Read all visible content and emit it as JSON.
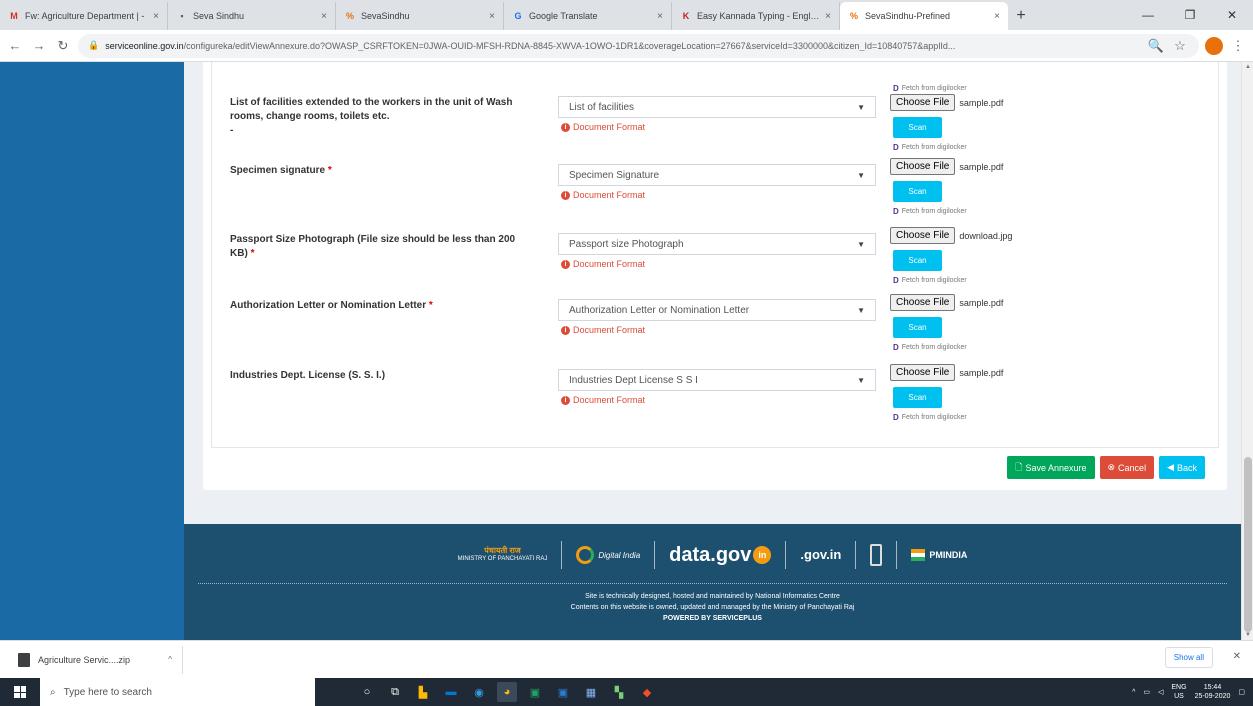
{
  "browser": {
    "tabs": [
      {
        "title": "Fw: Agriculture Department | -",
        "icon": "gmail-icon",
        "color": "#d93025",
        "active": false
      },
      {
        "title": "Seva Sindhu",
        "icon": "doc-icon",
        "color": "#5f6368",
        "active": false
      },
      {
        "title": "SevaSindhu",
        "icon": "sevasindhu-icon",
        "color": "#e8710a",
        "active": false
      },
      {
        "title": "Google Translate",
        "icon": "translate-icon",
        "color": "#1a73e8",
        "active": false
      },
      {
        "title": "Easy Kannada Typing - English",
        "icon": "k-icon",
        "color": "#c5221f",
        "active": false
      },
      {
        "title": "SevaSindhu-Prefined",
        "icon": "sevasindhu-icon",
        "color": "#e8710a",
        "active": true
      }
    ],
    "url_host": "serviceonline.gov.in",
    "url_path": "/configureka/editViewAnnexure.do?OWASP_CSRFTOKEN=0JWA-OUID-MFSH-RDNA-8845-XWVA-1OWO-1DR1&coverageLocation=27667&serviceId=3300000&citizen_Id=10840757&applId..."
  },
  "form": {
    "rows": [
      {
        "label": "List of facilities extended to the workers in the unit of Wash rooms, change rooms, toilets etc.",
        "required": false,
        "select": "List of facilities",
        "format": "Document Format",
        "choose_label": "Choose File",
        "file": "sample.pdf",
        "scan": "Scan",
        "digi": "Fetch from digilocker"
      },
      {
        "label": "Specimen signature",
        "required": true,
        "select": "Specimen Signature",
        "format": "Document Format",
        "choose_label": "Choose File",
        "file": "sample.pdf",
        "scan": "Scan",
        "digi": "Fetch from digilocker"
      },
      {
        "label": "Passport Size Photograph (File size should be less than 200 KB)",
        "required": true,
        "select": "Passport size Photograph",
        "format": "Document Format",
        "choose_label": "Choose File",
        "file": "download.jpg",
        "scan": "Scan",
        "digi": "Fetch from digilocker"
      },
      {
        "label": "Authorization Letter or Nomination Letter",
        "required": true,
        "select": "Authorization Letter or Nomination Letter",
        "format": "Document Format",
        "choose_label": "Choose File",
        "file": "sample.pdf",
        "scan": "Scan",
        "digi": "Fetch from digilocker"
      },
      {
        "label": "Industries Dept. License (S. S. I.)",
        "required": false,
        "select": "Industries Dept License S S I",
        "format": "Document Format",
        "choose_label": "Choose File",
        "file": "sample.pdf",
        "scan": "Scan",
        "digi": "Fetch from digilocker"
      }
    ],
    "top_digi": "Fetch from digilocker",
    "actions": {
      "save": "Save Annexure",
      "cancel": "Cancel",
      "back": "Back"
    }
  },
  "footer": {
    "mopr_hindi": "पंचायती राज",
    "mopr": "MINISTRY OF PANCHAYATI RAJ",
    "digital": "Digital India",
    "datagov": "data.gov",
    "datagov_in": "in",
    "goin": ".gov.in",
    "pmindia": "PMINDIA",
    "line1": "Site is technically designed, hosted and maintained by National Informatics Centre",
    "line2": "Contents on this website is owned, updated and managed by the Ministry of Panchayati Raj",
    "line3": "POWERED BY SERVICEPLUS"
  },
  "downloads": {
    "file": "Agriculture Servic....zip",
    "show_all": "Show all"
  },
  "taskbar": {
    "search_placeholder": "Type here to search",
    "lang1": "ENG",
    "lang2": "US",
    "time": "15:44",
    "date": "25-09-2020"
  },
  "colors": {
    "sidebar": "#1a6aa6",
    "footer": "#1d4f6e",
    "save": "#00a65a",
    "cancel": "#dd4b39",
    "back": "#00c0ef"
  }
}
